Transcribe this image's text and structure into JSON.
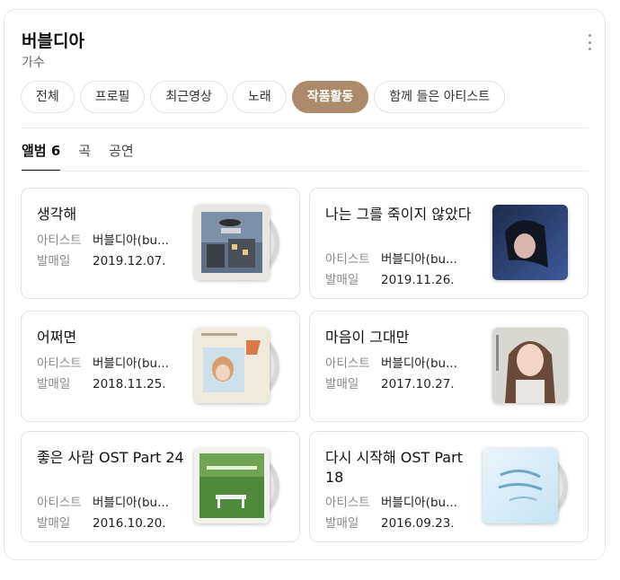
{
  "header": {
    "title": "버블디아",
    "subtitle": "가수"
  },
  "chips": [
    "전체",
    "프로필",
    "최근영상",
    "노래",
    "작품활동",
    "함께 들은 아티스트"
  ],
  "tabs": {
    "album": "앨범",
    "album_count": "6",
    "song": "곡",
    "concert": "공연"
  },
  "meta_labels": {
    "artist": "아티스트",
    "release": "발매일"
  },
  "albums": [
    {
      "title": "생각해",
      "artist": "버블디아(bu...",
      "date": "2019.12.07."
    },
    {
      "title": "나는 그를 죽이지 않았다",
      "artist": "버블디아(bu...",
      "date": "2019.11.26."
    },
    {
      "title": "어쩌면",
      "artist": "버블디아(bu...",
      "date": "2018.11.25."
    },
    {
      "title": "마음이 그대만",
      "artist": "버블디아(bu...",
      "date": "2017.10.27."
    },
    {
      "title": "좋은 사람 OST Part 24",
      "artist": "버블디아(bu...",
      "date": "2016.10.20."
    },
    {
      "title": "다시 시작해 OST Part 18",
      "artist": "버블디아(bu...",
      "date": "2016.09.23."
    }
  ],
  "colors": {
    "accent": "#ad8b6a"
  }
}
